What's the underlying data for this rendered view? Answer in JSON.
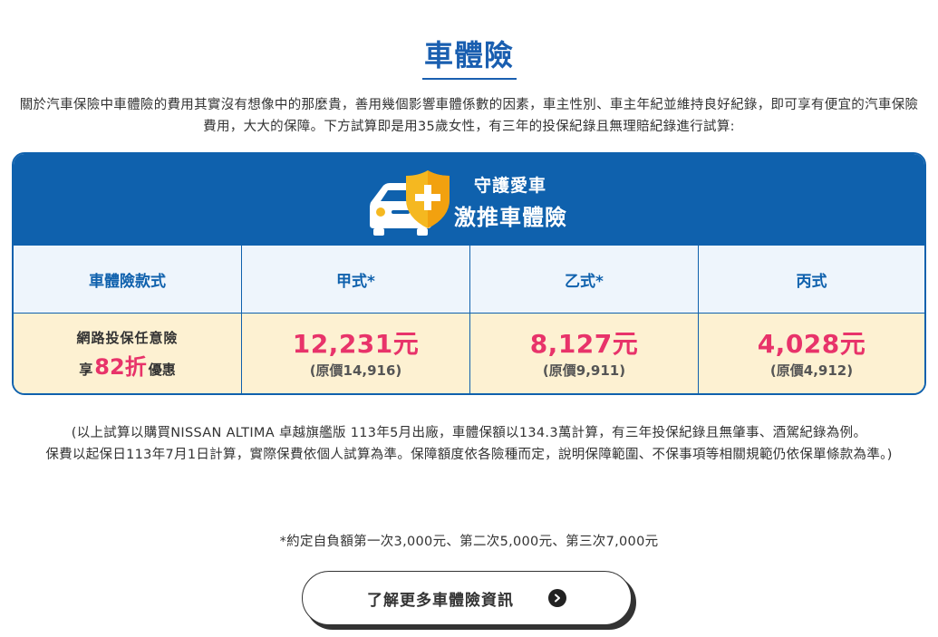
{
  "page": {
    "title": "車體險",
    "intro": "關於汽車保險中車體險的費用其實沒有想像中的那麼貴，善用幾個影響車體係數的因素，車主性別、車主年紀並維持良好紀錄，即可享有便宜的汽車保險費用，大大的保障。下方試算即是用35歲女性，有三年的投保紀錄且無理賠紀錄進行試算:"
  },
  "banner": {
    "line1": "守護愛車",
    "line2": "激推車體險",
    "icons": [
      "car-icon",
      "shield-plus-icon"
    ],
    "colors": {
      "header_bg": "#0f61ad",
      "car": "#ffffff",
      "shield": "#f5b820"
    }
  },
  "table": {
    "headers": [
      "車體險款式",
      "甲式*",
      "乙式*",
      "丙式"
    ],
    "promo": {
      "line1": "網路投保任意險",
      "prefix": "享",
      "discount": "82折",
      "suffix": "優惠"
    },
    "plans": [
      {
        "price": "12,231元",
        "original": "(原價14,916)"
      },
      {
        "price": "8,127元",
        "original": "(原價9,911)"
      },
      {
        "price": "4,028元",
        "original": "(原價4,912)"
      }
    ],
    "colors": {
      "header_row_bg": "#eef5fc",
      "body_row_bg": "#fdf1d2",
      "price": "#e8336a",
      "border": "#0f61ad"
    }
  },
  "notes": {
    "line1": "(以上試算以購買NISSAN ALTIMA 卓越旗艦版 113年5月出廠，車體保額以134.3萬計算，有三年投保紀錄且無肇事、酒駕紀錄為例。",
    "line2": "保費以起保日113年7月1日計算，實際保費依個人試算為準。保障額度依各險種而定，說明保障範圍、不保事項等相關規範仍依保單條款為準。)",
    "deductible": "*約定自負額第一次3,000元、第二次5,000元、第三次7,000元"
  },
  "cta": {
    "label": "了解更多車體險資訊",
    "icon": "chevron-right-circle-icon"
  }
}
